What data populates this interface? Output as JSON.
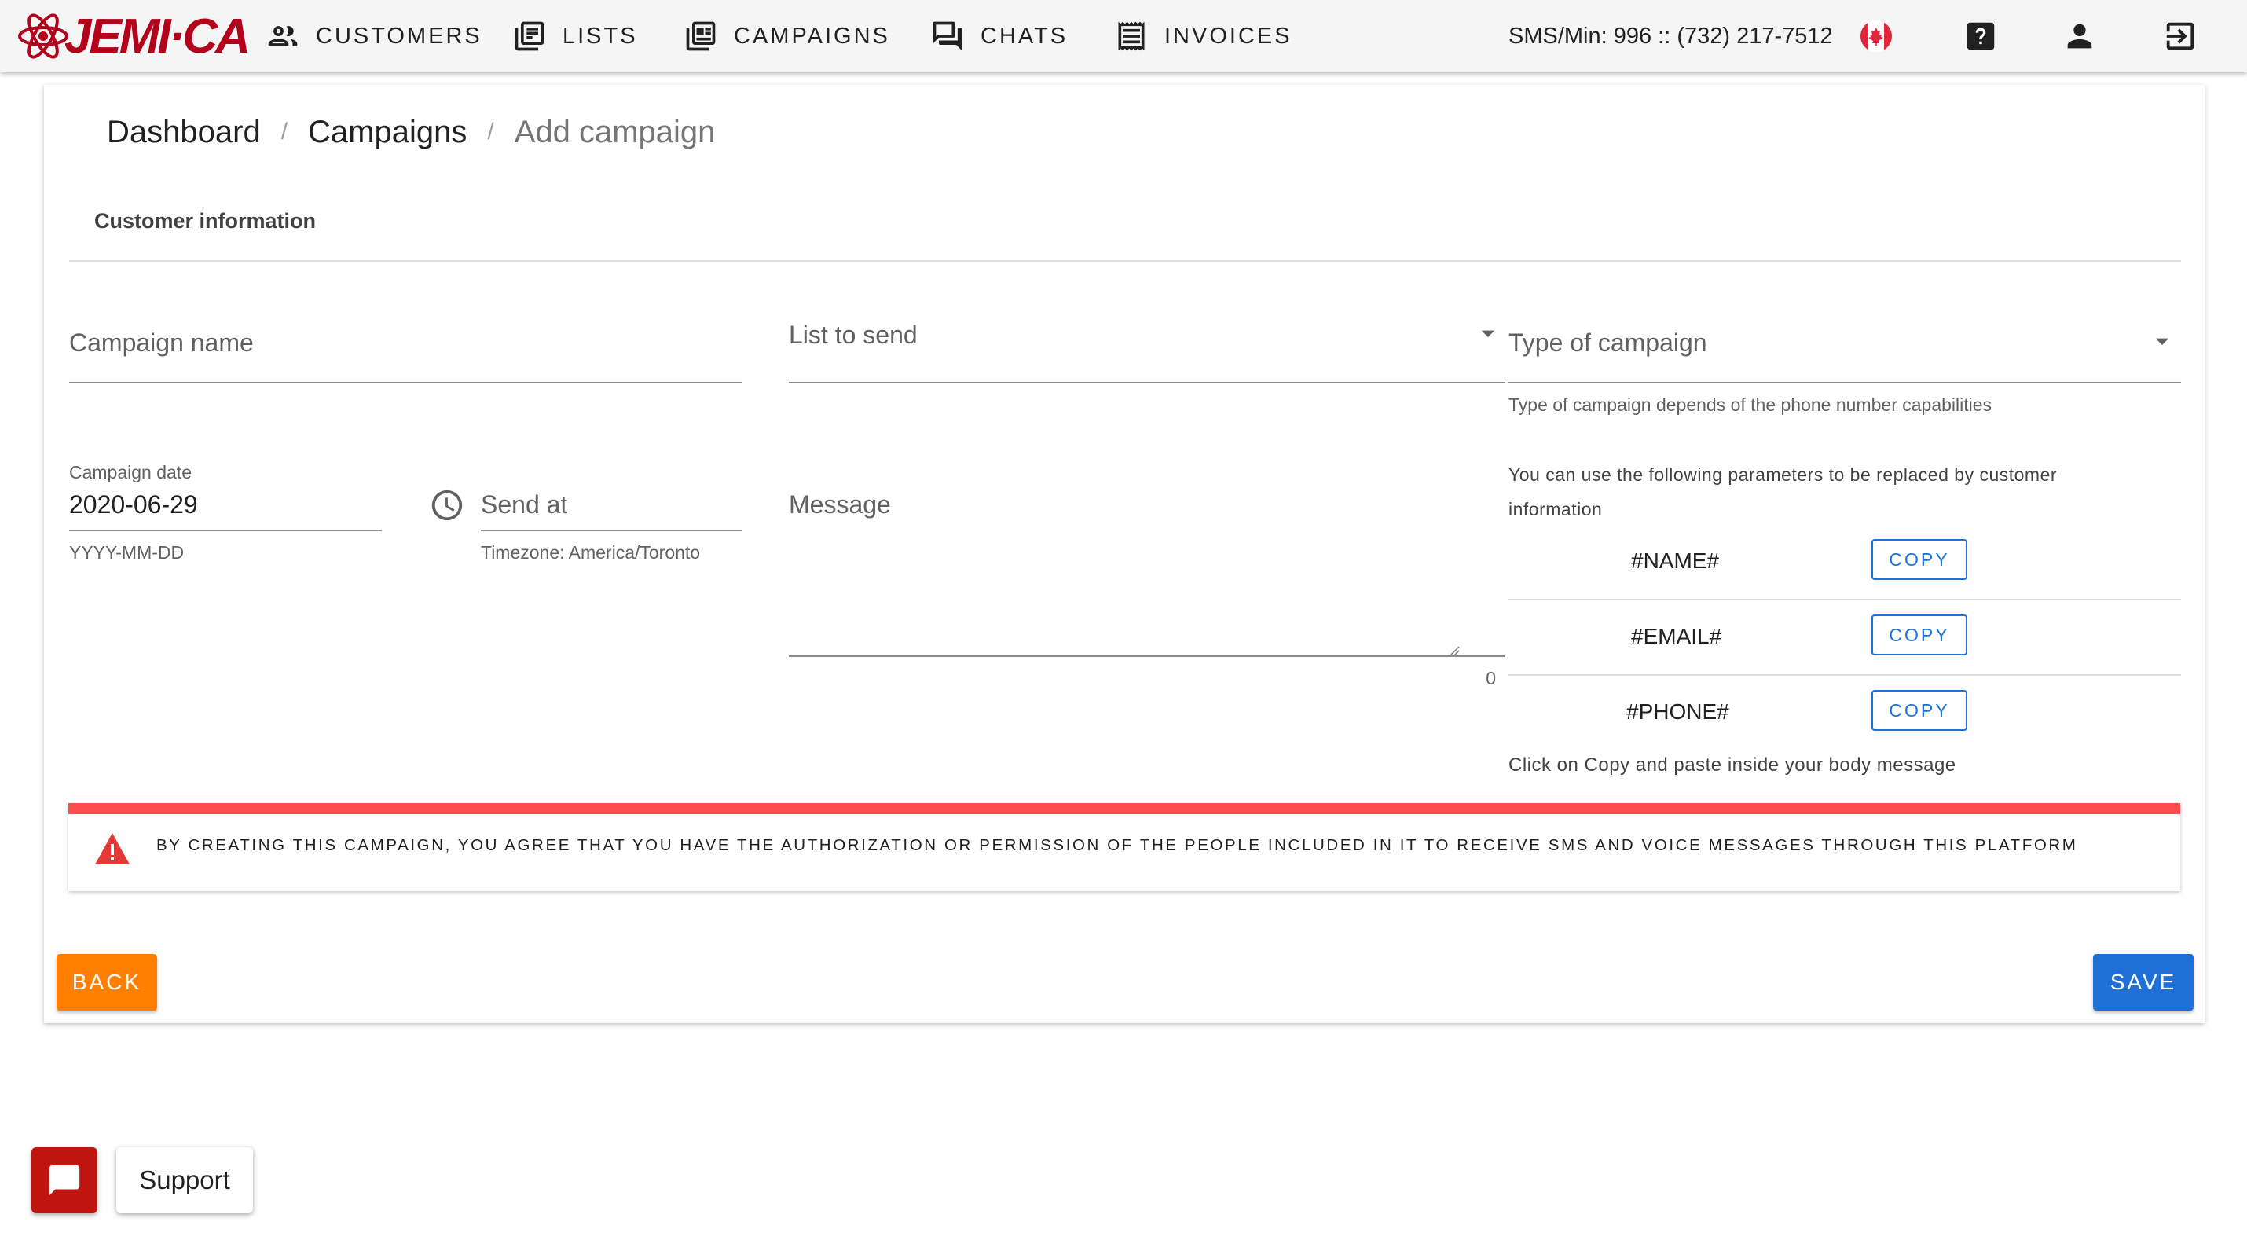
{
  "brand": {
    "logo_text": "JEMI·CA",
    "accent": "#b3001b"
  },
  "nav": [
    {
      "label": "CUSTOMERS",
      "icon": "people-icon"
    },
    {
      "label": "LISTS",
      "icon": "list-icon"
    },
    {
      "label": "CAMPAIGNS",
      "icon": "campaign-icon"
    },
    {
      "label": "CHATS",
      "icon": "chat-icon"
    },
    {
      "label": "INVOICES",
      "icon": "receipt-icon"
    }
  ],
  "topbar": {
    "sms_info": "SMS/Min: 996 :: (732) 217-7512",
    "flag_icon": "canada-flag-icon",
    "help_icon": "help-icon",
    "account_icon": "account-icon",
    "logout_icon": "logout-icon"
  },
  "breadcrumb": {
    "items": [
      "Dashboard",
      "Campaigns"
    ],
    "separator": "/",
    "current": "Add campaign"
  },
  "section": {
    "title": "Customer information"
  },
  "form": {
    "campaign_name": {
      "placeholder": "Campaign name",
      "value": ""
    },
    "list_to_send": {
      "placeholder": "List to send",
      "value": ""
    },
    "type_of_campaign": {
      "placeholder": "Type of campaign",
      "hint": "Type of campaign depends of the phone number capabilities"
    },
    "campaign_date": {
      "label": "Campaign date",
      "value": "2020-06-29",
      "hint": "YYYY-MM-DD"
    },
    "send_at": {
      "placeholder": "Send at",
      "hint": "Timezone: America/Toronto"
    },
    "message": {
      "placeholder": "Message",
      "counter": "0"
    }
  },
  "parameters": {
    "intro": "You can use the following parameters to be replaced by customer information",
    "items": [
      {
        "name": "#NAME#",
        "button": "COPY"
      },
      {
        "name": "#EMAIL#",
        "button": "COPY"
      },
      {
        "name": "#PHONE#",
        "button": "COPY"
      }
    ],
    "footer": "Click on Copy and paste inside your body message"
  },
  "alert": {
    "icon": "warning-icon",
    "text": "BY CREATING THIS CAMPAIGN, YOU AGREE THAT YOU HAVE THE AUTHORIZATION OR PERMISSION OF THE PEOPLE INCLUDED IN IT TO RECEIVE SMS AND VOICE MESSAGES THROUGH THIS PLATFORM",
    "color": "#ff4d4d"
  },
  "actions": {
    "back_label": "BACK",
    "back_color": "#ff8000",
    "save_label": "SAVE",
    "save_color": "#1e6fd6"
  },
  "support": {
    "label": "Support",
    "color": "#c0140f"
  }
}
